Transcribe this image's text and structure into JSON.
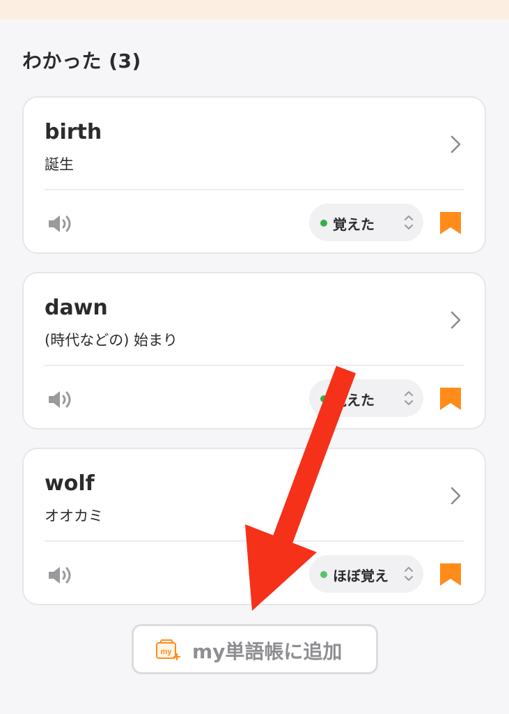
{
  "section": {
    "title": "わかった (3)"
  },
  "cards": [
    {
      "word": "birth",
      "meaning": "誕生",
      "status": "覚えた",
      "status_color": "#2fb14a"
    },
    {
      "word": "dawn",
      "meaning": "(時代などの) 始まり",
      "status": "覚えた",
      "status_color": "#2fb14a"
    },
    {
      "word": "wolf",
      "meaning": "オオカミ",
      "status": "ほぼ覚え",
      "status_color": "#55c46a"
    }
  ],
  "add_button": {
    "icon": "my-wordbook-icon",
    "icon_text": "my",
    "label": "my単語帳に追加"
  },
  "icons": {
    "chevron": "chevron-right-icon",
    "speaker": "speaker-icon",
    "status_toggle": "updown-chevron-icon",
    "bookmark": "bookmark-icon",
    "annotation": "red-arrow-annotation"
  },
  "colors": {
    "accent": "#ff8c1a",
    "top_strip": "#fdeee2",
    "annotation_arrow": "#f5311a",
    "button_text": "#8e8e93"
  }
}
